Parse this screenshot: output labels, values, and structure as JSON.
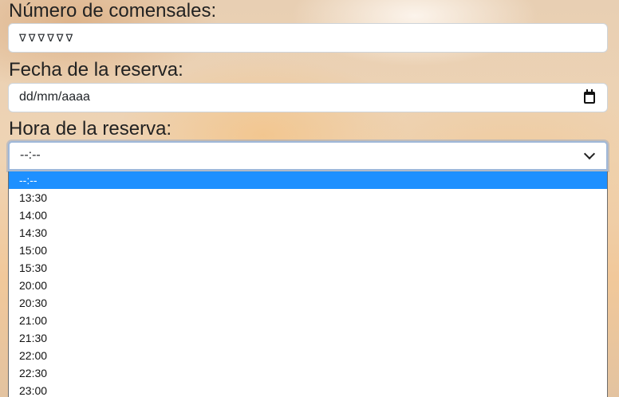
{
  "form": {
    "guests": {
      "label": "Número de comensales:",
      "value": "∇∇∇∇∇∇"
    },
    "date": {
      "label": "Fecha de la reserva:",
      "placeholder": "dd/mm/aaaa",
      "icon": "calendar-icon"
    },
    "time": {
      "label": "Hora de la reserva:",
      "selected": "--:--",
      "icon": "chevron-down-icon",
      "options": [
        "--:--",
        "13:30",
        "14:00",
        "14:30",
        "15:00",
        "15:30",
        "20:00",
        "20:30",
        "21:00",
        "21:30",
        "22:00",
        "22:30",
        "23:00"
      ]
    }
  },
  "colors": {
    "highlight": "#1e90ff",
    "focus_ring": "#9fb8d9"
  }
}
